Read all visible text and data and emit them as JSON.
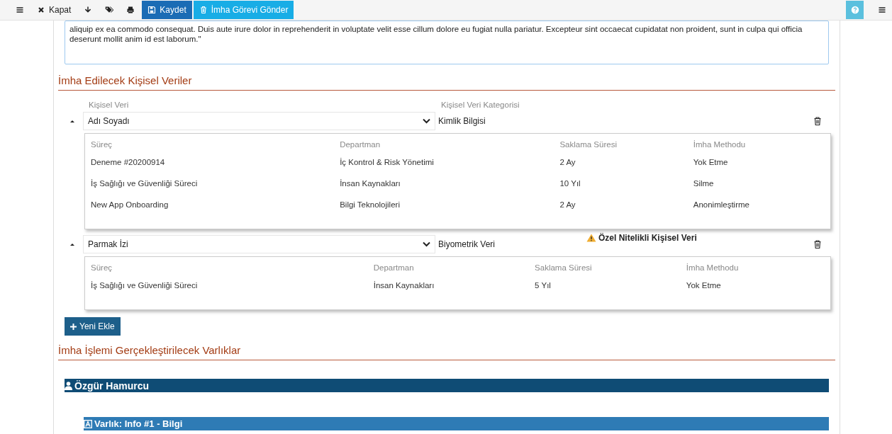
{
  "toolbar": {
    "left": [
      {
        "kind": "menu"
      },
      {
        "kind": "close",
        "label": "Kapat"
      },
      {
        "kind": "download"
      },
      {
        "kind": "tags"
      },
      {
        "kind": "print"
      },
      {
        "kind": "save",
        "label": "Kaydet"
      },
      {
        "kind": "send",
        "label": "İmha Görevi Gönder"
      }
    ],
    "right": [
      {
        "kind": "help"
      },
      {
        "kind": "menu"
      }
    ]
  },
  "description": {
    "value": "aliquip ex ea commodo consequat. Duis aute irure dolor in reprehenderit in voluptate velit esse cillum dolore eu fugiat nulla pariatur. Excepteur sint occaecat cupidatat non proident, sunt in culpa qui officia deserunt mollit anim id est laborum.\""
  },
  "personal_data": {
    "title": "İmha Edilecek Kişisel Veriler",
    "column_labels": [
      "Kişisel Veri",
      "Kişisel Veri Kategorisi"
    ],
    "items": [
      {
        "expanded": true,
        "value": "Adı Soyadı",
        "category": "Kimlik Bilgisi",
        "columns": [
          "Süreç",
          "Departman",
          "Saklama Süresi",
          "İmha Methodu"
        ],
        "rows": [
          [
            "Deneme #20200914",
            "İç Kontrol & Risk Yönetimi",
            "2 Ay",
            "Yok Etme"
          ],
          [
            "İş Sağlığı ve Güvenliği Süreci",
            "İnsan Kaynakları",
            "10 Yıl",
            "Silme"
          ],
          [
            "New App Onboarding",
            "Bilgi Teknolojileri",
            "2 Ay",
            "Anonimleştirme"
          ]
        ]
      },
      {
        "expanded": true,
        "value": "Parmak İzi",
        "category": "Biyometrik Veri",
        "warning": "Özel Nitelikli Kişisel Veri",
        "columns": [
          "Süreç",
          "Departman",
          "Saklama Süresi",
          "İmha Methodu"
        ],
        "rows": [
          [
            "İş Sağlığı ve Güvenliği Süreci",
            "İnsan Kaynakları",
            "5 Yıl",
            "Yok Etme"
          ]
        ]
      }
    ],
    "add_button": "Yeni Ekle"
  },
  "assets": {
    "title": "İmha İşlemi Gerçekleştirilecek Varlıklar",
    "person": "Özgür Hamurcu",
    "asset": "Varlık: Info #1 - Bilgi"
  }
}
